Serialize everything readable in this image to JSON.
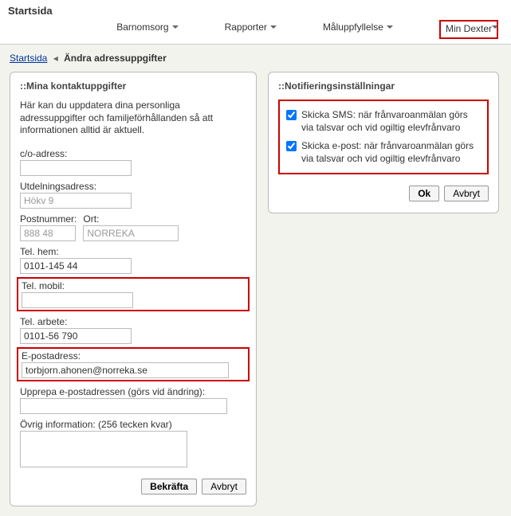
{
  "header": {
    "page_title": "Startsida",
    "tabs": [
      "Barnomsorg",
      "Rapporter",
      "Måluppfyllelse",
      "Min Dexter"
    ]
  },
  "breadcrumb": {
    "root": "Startsida",
    "current": "Ändra adressuppgifter"
  },
  "contact_panel": {
    "title": "::Mina kontaktuppgifter",
    "intro": "Här kan du uppdatera dina personliga adressuppgifter och familjeförhållanden så att informationen alltid är aktuell.",
    "co_label": "c/o-adress:",
    "co_value": "",
    "utd_label": "Utdelningsadress:",
    "utd_value": "Hökv 9",
    "postnr_label": "Postnummer:",
    "postnr_value": "888 48",
    "ort_label": "Ort:",
    "ort_value": "NORREKA",
    "telhem_label": "Tel. hem:",
    "telhem_value": "0101-145 44",
    "telmobil_label": "Tel. mobil:",
    "telmobil_value": "",
    "telarb_label": "Tel. arbete:",
    "telarb_value": "0101-56 790",
    "email_label": "E-postadress:",
    "email_value": "torbjorn.ahonen@norreka.se",
    "email_repeat_label": "Upprepa e-postadressen (görs vid ändring):",
    "email_repeat_value": "",
    "extra_label": "Övrig information: (256 tecken kvar)",
    "extra_value": "",
    "confirm_btn": "Bekräfta",
    "cancel_btn": "Avbryt"
  },
  "notif_panel": {
    "title": "::Notifieringsinställningar",
    "sms_label": "Skicka SMS: när frånvaroanmälan görs via talsvar och vid ogiltig elevfrånvaro",
    "sms_checked": true,
    "email_label": "Skicka e-post: när frånvaroanmälan görs via talsvar och vid ogiltig elevfrånvaro",
    "email_checked": true,
    "ok_btn": "Ok",
    "cancel_btn": "Avbryt"
  }
}
